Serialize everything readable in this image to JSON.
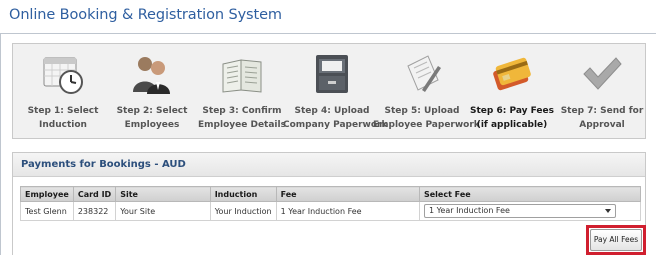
{
  "app": {
    "title": "Online Booking & Registration System"
  },
  "steps": [
    {
      "line1": "Step 1: Select",
      "line2": "Induction",
      "icon": "calendar-clock-icon",
      "active": false
    },
    {
      "line1": "Step 2: Select",
      "line2": "Employees",
      "icon": "people-icon",
      "active": false
    },
    {
      "line1": "Step 3: Confirm",
      "line2": "Employee Details",
      "icon": "open-book-icon",
      "active": false
    },
    {
      "line1": "Step 4: Upload",
      "line2": "Company Paperwork",
      "icon": "filing-cabinet-icon",
      "active": false
    },
    {
      "line1": "Step 5: Upload",
      "line2": "Employee Paperwork",
      "icon": "document-pen-icon",
      "active": false
    },
    {
      "line1": "Step 6: Pay Fees",
      "line2": "(if applicable)",
      "icon": "credit-cards-icon",
      "active": true
    },
    {
      "line1": "Step 7: Send for",
      "line2": "Approval",
      "icon": "checkmark-icon",
      "active": false
    }
  ],
  "payments": {
    "title": "Payments for Bookings - AUD",
    "columns": [
      "Employee",
      "Card ID",
      "Site",
      "Induction",
      "Fee",
      "Select Fee"
    ],
    "rows": [
      {
        "employee": "Test Glenn",
        "card_id": "238322",
        "site": "Your Site",
        "induction": "Your Induction",
        "fee": "1 Year Induction Fee",
        "select_fee": "1 Year Induction Fee"
      }
    ],
    "pay_all_label": "Pay All Fees"
  },
  "colors": {
    "title": "#2f5fa0",
    "header_text": "#2c4f7c",
    "highlight": "#d01f2f"
  }
}
